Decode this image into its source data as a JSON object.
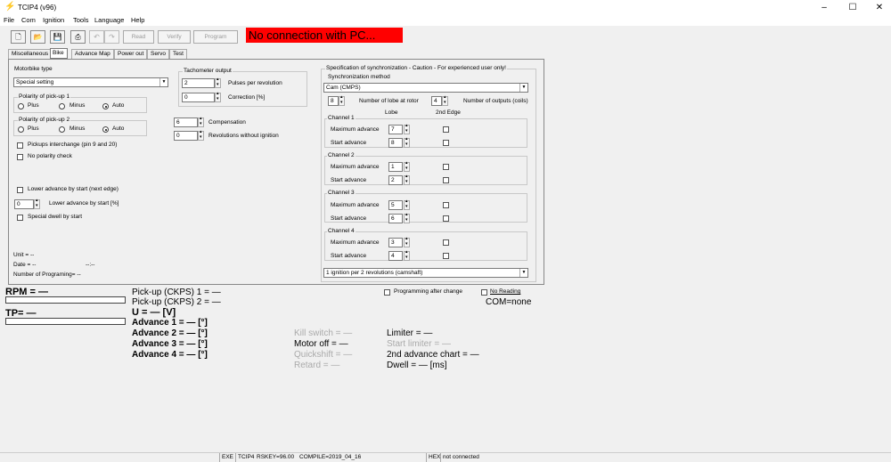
{
  "window": {
    "title": "TCIP4 (v96)"
  },
  "menu": [
    "File",
    "Com",
    "Ignition",
    "Tools",
    "Language",
    "Help"
  ],
  "toolbar": {
    "read": "Read",
    "verify": "Verify",
    "program": "Program",
    "banner": "No connection with PC..."
  },
  "tabs": [
    "Miscellaneous",
    "Bike",
    "Advance Map",
    "Power out",
    "Servo",
    "Test"
  ],
  "left": {
    "motorbike_type_label": "Motorbike type",
    "motorbike_type_value": "Special setting",
    "pol1_title": "Polarity of pick-up 1",
    "pol2_title": "Polarity of pick-up 2",
    "plus": "Plus",
    "minus": "Minus",
    "auto": "Auto",
    "pickups_interchange": "Pickups interchange (pin 9 and 20)",
    "no_polarity": "No polarity check",
    "lower_adv_edge": "Lower advance by start (next edge)",
    "lower_adv_val": "0",
    "lower_adv_label": "Lower advance by start [%]",
    "special_dwell": "Special dwell by start",
    "unit": "Unit = --",
    "date": "Date = --",
    "date_time": "--:--",
    "num_prog": "Number of Programing= --"
  },
  "tach": {
    "title": "Tachometer output",
    "pulses_val": "2",
    "pulses_label": "Pulses per revolution",
    "corr_val": "0",
    "corr_label": "Correction [%]",
    "comp_val": "6",
    "comp_label": "Compensation",
    "rev_val": "0",
    "rev_label": "Revolutions without ignition"
  },
  "sync": {
    "title": "Specification of synchronization - Caution - For experienced user only!",
    "method_label": "Synchronization method",
    "method_value": "Cam (CMPS)",
    "lobe_val": "8",
    "lobe_label": "Number of lobe at rotor",
    "outputs_val": "4",
    "outputs_label": "Number of outputs (coils)",
    "col_lobe": "Lobe",
    "col_edge": "2nd Edge",
    "max_adv": "Maximum advance",
    "start_adv": "Start advance",
    "channels": [
      {
        "name": "Channel 1",
        "max": "7",
        "start": "8"
      },
      {
        "name": "Channel 2",
        "max": "1",
        "start": "2"
      },
      {
        "name": "Channel 3",
        "max": "5",
        "start": "6"
      },
      {
        "name": "Channel 4",
        "max": "3",
        "start": "4"
      }
    ],
    "ignition_mode": "1 ignition per 2 revolutions (camshaft)"
  },
  "bottom": {
    "prog_after": "Programming after change",
    "no_reading": "No Reading",
    "com": "COM=none",
    "rpm": "RPM = —",
    "tp": "TP= —",
    "ckps1": "Pick-up (CKPS) 1 = —",
    "ckps2": "Pick-up (CKPS) 2 = —",
    "u": "U = — [V]",
    "adv1": "Advance 1 = — [°]",
    "adv2": "Advance 2 = — [°]",
    "adv3": "Advance 3 = — [°]",
    "adv4": "Advance 4 = — [°]",
    "kill": "Kill switch = —",
    "motor_off": "Motor off = —",
    "quickshift": "Quickshift = —",
    "retard": "Retard = —",
    "limiter": "Limiter = —",
    "start_limiter": "Start limiter = —",
    "second_adv": "2nd advance chart = —",
    "dwell": "Dwell = — [ms]"
  },
  "status": {
    "exe": "EXE",
    "app": "TCIP4",
    "rskey": "RSKEY=96.00",
    "compile": "COMPILE=2019_04_16",
    "hex": "HEX",
    "conn": "not connected"
  }
}
